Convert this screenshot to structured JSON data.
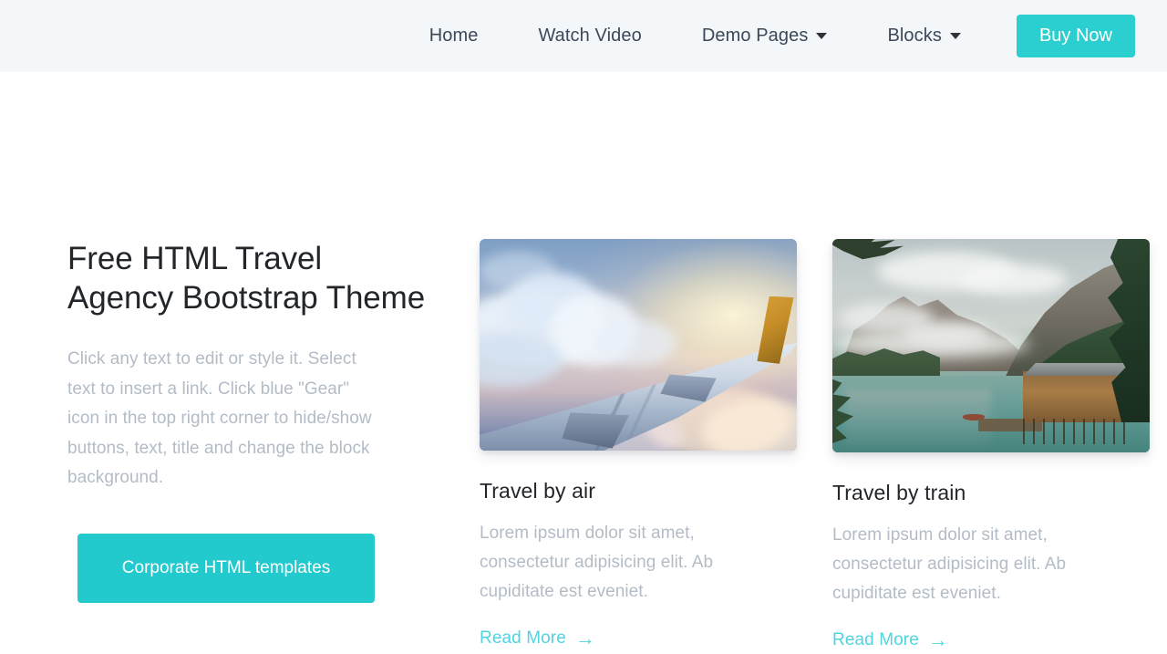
{
  "theme": {
    "accent": "#2bcfcf",
    "cta": "#22c9cd",
    "link": "#4fd4e0",
    "header_bg": "#f3f7f9",
    "heading_color": "#22252a",
    "muted_text": "#b3bcc6",
    "nav_text": "#3c4858"
  },
  "header": {
    "nav": [
      {
        "label": "Home",
        "has_caret": false
      },
      {
        "label": "Watch Video",
        "has_caret": false
      },
      {
        "label": "Demo Pages",
        "has_caret": true
      },
      {
        "label": "Blocks",
        "has_caret": true
      }
    ],
    "cta_label": "Buy Now"
  },
  "hero": {
    "title": "Free HTML Travel Agency Bootstrap Theme",
    "text": "Click any text to edit or style it. Select text to insert a link. Click blue \"Gear\" icon in the top right corner to hide/show buttons, text, title and change the block background.",
    "button_label": "Corporate HTML templates"
  },
  "cards": [
    {
      "image_alt": "airplane-wing-above-clouds-at-sunset",
      "title": "Travel by air",
      "text": "Lorem ipsum dolor sit amet, consectetur adipisicing elit. Ab cupiditate est eveniet.",
      "link_label": "Read More",
      "link_arrow": "→"
    },
    {
      "image_alt": "mountain-lake-with-wooden-boathouse",
      "title": "Travel by train",
      "text": "Lorem ipsum dolor sit amet, consectetur adipisicing elit. Ab cupiditate est eveniet.",
      "link_label": "Read More",
      "link_arrow": "→"
    }
  ]
}
